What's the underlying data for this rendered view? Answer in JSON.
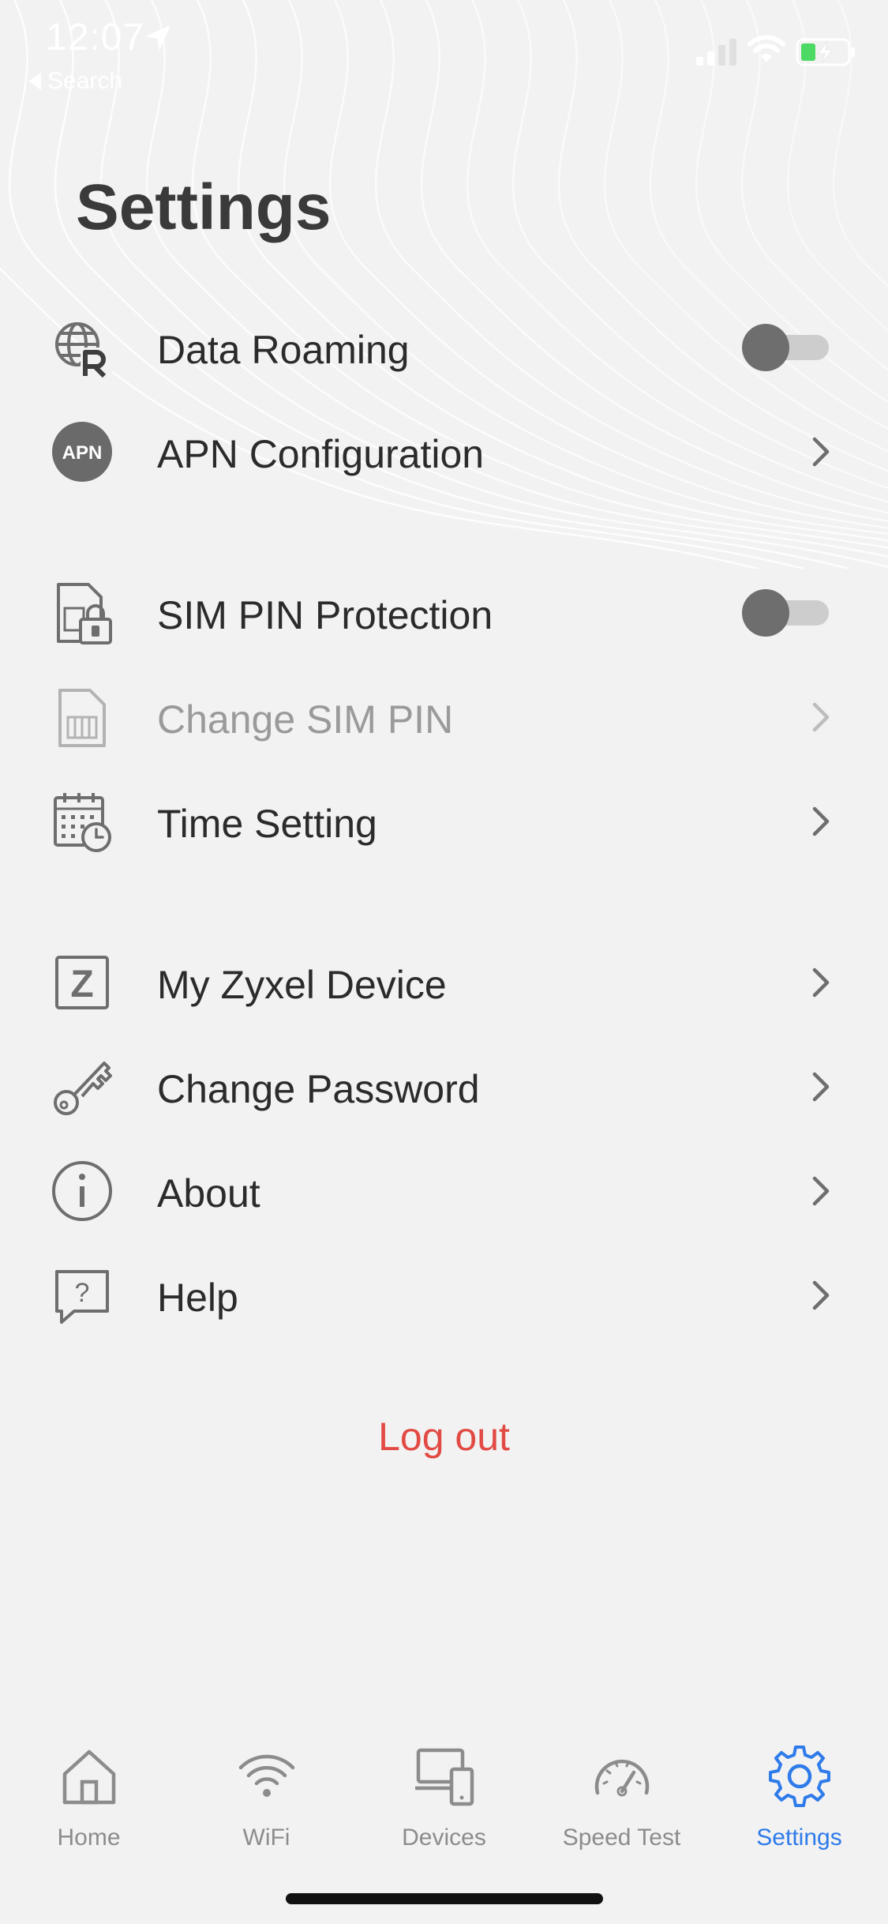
{
  "status_bar": {
    "time": "12:07",
    "back_app": "Search",
    "icons": [
      "location-arrow-icon",
      "cellular-signal-icon",
      "wifi-icon",
      "battery-charging-icon"
    ]
  },
  "page_title": "Settings",
  "groups": [
    {
      "items": [
        {
          "label": "Data Roaming",
          "icon": "globe-roaming-icon",
          "control": "toggle",
          "on": false
        },
        {
          "label": "APN Configuration",
          "icon": "apn-icon",
          "icon_text": "APN",
          "control": "chevron"
        }
      ]
    },
    {
      "items": [
        {
          "label": "SIM PIN Protection",
          "icon": "sim-lock-icon",
          "control": "toggle",
          "on": false
        },
        {
          "label": "Change SIM PIN",
          "icon": "sim-card-icon",
          "control": "chevron",
          "disabled": true
        },
        {
          "label": "Time Setting",
          "icon": "calendar-clock-icon",
          "control": "chevron"
        }
      ]
    },
    {
      "items": [
        {
          "label": "My Zyxel Device",
          "icon": "zyxel-z-icon",
          "icon_text": "Z",
          "control": "chevron"
        },
        {
          "label": "Change Password",
          "icon": "key-icon",
          "control": "chevron"
        },
        {
          "label": "About",
          "icon": "info-icon",
          "control": "chevron"
        },
        {
          "label": "Help",
          "icon": "help-bubble-icon",
          "control": "chevron"
        }
      ]
    }
  ],
  "logout_label": "Log out",
  "tabs": [
    {
      "label": "Home",
      "icon": "home-icon",
      "active": false
    },
    {
      "label": "WiFi",
      "icon": "wifi-icon",
      "active": false
    },
    {
      "label": "Devices",
      "icon": "devices-icon",
      "active": false
    },
    {
      "label": "Speed Test",
      "icon": "speedometer-icon",
      "active": false
    },
    {
      "label": "Settings",
      "icon": "gear-icon",
      "active": true
    }
  ],
  "colors": {
    "background": "#f2f2f2",
    "text": "#2b2b2b",
    "disabled_text": "#9a9a9a",
    "logout": "#e24a44",
    "active_tab": "#2e7bea",
    "inactive_tab": "#8c8c8c",
    "icon_gray": "#6e6e6e"
  }
}
